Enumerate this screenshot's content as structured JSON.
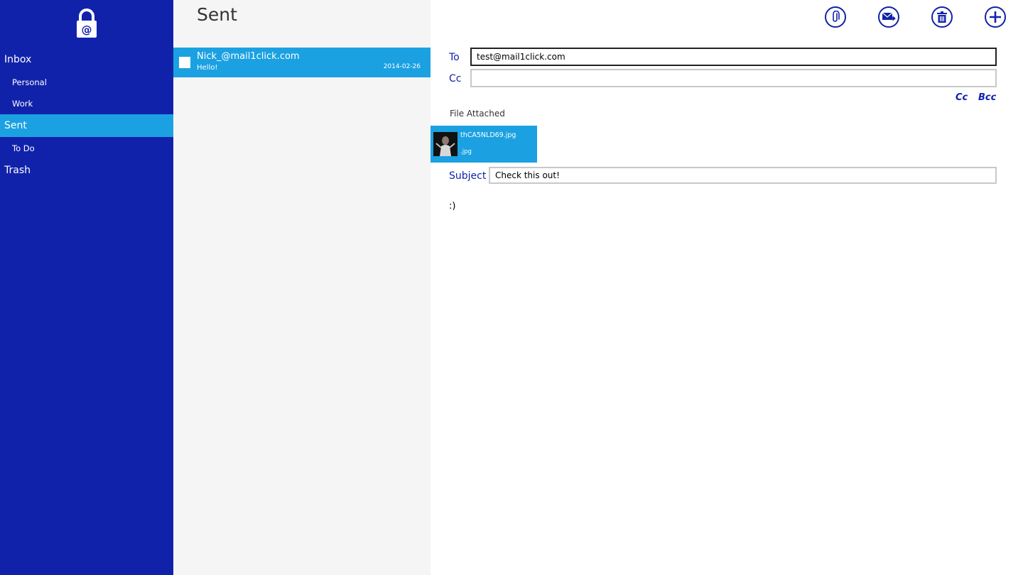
{
  "sidebar": {
    "logo_icon": "lock-at-icon",
    "items": [
      {
        "label": "Inbox"
      },
      {
        "label": "Personal"
      },
      {
        "label": "Work"
      },
      {
        "label": "Sent"
      },
      {
        "label": "To Do"
      },
      {
        "label": "Trash"
      }
    ],
    "active_item": "Sent"
  },
  "message_list": {
    "title": "Sent",
    "messages": [
      {
        "from": "Nick_@mail1click.com",
        "subject": "Hello!",
        "date": "2014-02-26",
        "selected": true
      }
    ]
  },
  "toolbar": {
    "buttons": [
      {
        "icon": "paperclip-icon"
      },
      {
        "icon": "send-mail-icon"
      },
      {
        "icon": "trash-icon"
      },
      {
        "icon": "plus-icon"
      }
    ]
  },
  "compose": {
    "to_label": "To",
    "to_value": "test@mail1click.com",
    "cc_label": "Cc",
    "cc_value": "",
    "cc_link": "Cc",
    "bcc_link": "Bcc",
    "file_attached_label": "File Attached",
    "attachment": {
      "name": "thCA5NLD69.jpg",
      "ext": ".jpg"
    },
    "subject_label": "Subject",
    "subject_value": "Check this out!",
    "body": ":)"
  },
  "colors": {
    "sidebar_bg": "#1122aa",
    "accent": "#1ba1e2",
    "label_blue": "#1122aa",
    "list_bg": "#f5f5f5"
  }
}
